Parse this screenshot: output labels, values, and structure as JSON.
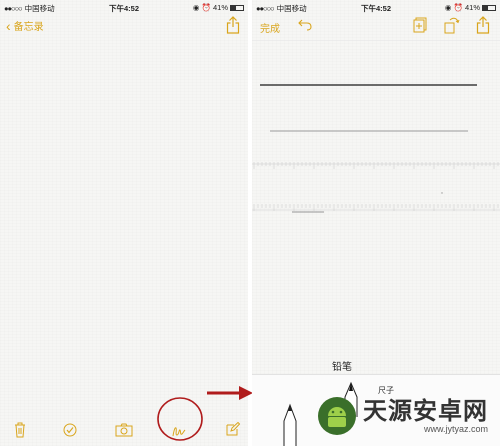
{
  "status_left": {
    "carrier": "中国移动",
    "time": "下午4:52",
    "battery": "41%"
  },
  "status_right": {
    "carrier": "中国移动",
    "time": "下午4:52",
    "battery": "41%"
  },
  "left_nav": {
    "back_label": "备忘录"
  },
  "right_nav": {
    "done_label": "完成"
  },
  "drawing_tools": {
    "selected_tool_label": "铅笔",
    "partial_label": "尺子"
  },
  "watermark": {
    "title": "天源安卓网",
    "url": "www.jytyaz.com"
  },
  "colors": {
    "accent": "#d9a51c",
    "highlight_circle": "#b01c1c",
    "arrow": "#b01c1c"
  },
  "icons": {
    "share": "share-icon",
    "undo": "undo-icon",
    "add": "add-icon",
    "rotate": "rotate-icon",
    "trash": "trash-icon",
    "checklist": "checklist-icon",
    "camera": "camera-icon",
    "sketch": "sketch-icon",
    "compose": "compose-icon"
  }
}
